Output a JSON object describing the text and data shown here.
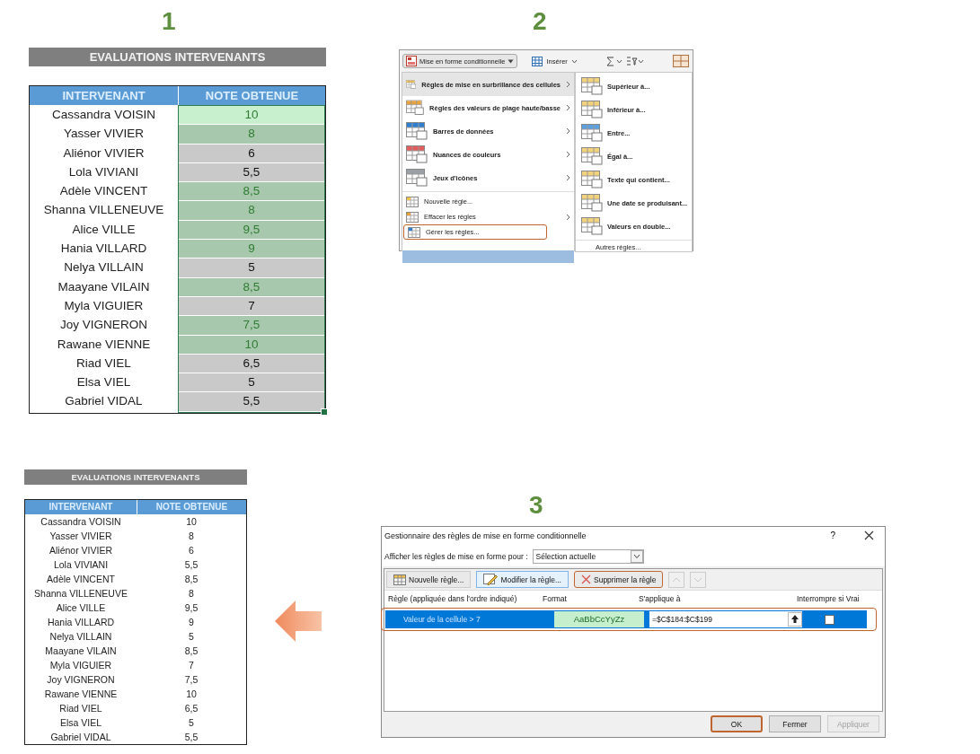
{
  "step_1": {
    "number": "1"
  },
  "table_before": {
    "title": "EVALUATIONS INTERVENANTS",
    "columns": [
      "INTERVENANT",
      "NOTE OBTENUE"
    ],
    "rows": [
      {
        "name": "Cassandra VOISIN",
        "note": "10",
        "highlighted": true,
        "active": true
      },
      {
        "name": "Yasser VIVIER",
        "note": "8",
        "highlighted": true,
        "active": false
      },
      {
        "name": "Aliénor VIVIER",
        "note": "6",
        "highlighted": false,
        "active": false
      },
      {
        "name": "Lola VIVIANI",
        "note": "5,5",
        "highlighted": false,
        "active": false
      },
      {
        "name": "Adèle VINCENT",
        "note": "8,5",
        "highlighted": true,
        "active": false
      },
      {
        "name": "Shanna VILLENEUVE",
        "note": "8",
        "highlighted": true,
        "active": false
      },
      {
        "name": "Alice VILLE",
        "note": "9,5",
        "highlighted": true,
        "active": false
      },
      {
        "name": "Hania VILLARD",
        "note": "9",
        "highlighted": true,
        "active": false
      },
      {
        "name": "Nelya VILLAIN",
        "note": "5",
        "highlighted": false,
        "active": false
      },
      {
        "name": "Maayane VILAIN",
        "note": "8,5",
        "highlighted": true,
        "active": false
      },
      {
        "name": "Myla VIGUIER",
        "note": "7",
        "highlighted": false,
        "active": false
      },
      {
        "name": "Joy VIGNERON",
        "note": "7,5",
        "highlighted": true,
        "active": false
      },
      {
        "name": "Rawane VIENNE",
        "note": "10",
        "highlighted": true,
        "active": false
      },
      {
        "name": "Riad VIEL",
        "note": "6,5",
        "highlighted": false,
        "active": false
      },
      {
        "name": "Elsa VIEL",
        "note": "5",
        "highlighted": false,
        "active": false
      },
      {
        "name": "Gabriel VIDAL",
        "note": "5,5",
        "highlighted": false,
        "active": false
      }
    ]
  },
  "step_2": {
    "number": "2"
  },
  "ribbon": {
    "conditional_format_button": "Mise en forme conditionnelle",
    "insert_button": "Insérer"
  },
  "menu": {
    "items": [
      {
        "label": "Règles de mise en surbrillance des cellules",
        "kind": "big",
        "submenu": true,
        "selected": true,
        "outlined": false
      },
      {
        "label": "Règles des valeurs de plage haute/basse",
        "kind": "big",
        "submenu": true,
        "selected": false,
        "outlined": false
      },
      {
        "label": "Barres de données",
        "kind": "big",
        "submenu": true,
        "selected": false,
        "outlined": false
      },
      {
        "label": "Nuances de couleurs",
        "kind": "big",
        "submenu": true,
        "selected": false,
        "outlined": false
      },
      {
        "label": "Jeux d'icônes",
        "kind": "big",
        "submenu": true,
        "selected": false,
        "outlined": false
      },
      {
        "label": "Nouvelle règle...",
        "kind": "small",
        "submenu": false,
        "selected": false,
        "outlined": false
      },
      {
        "label": "Effacer les règles",
        "kind": "small",
        "submenu": true,
        "selected": false,
        "outlined": false
      },
      {
        "label": "Gérer les règles...",
        "kind": "small",
        "submenu": false,
        "selected": false,
        "outlined": true
      }
    ],
    "submenu": [
      "Supérieur à...",
      "Inférieur à...",
      "Entre...",
      "Égal à...",
      "Texte qui contient...",
      "Une date se produisant...",
      "Valeurs en double..."
    ],
    "submenu_footer": "Autres règles..."
  },
  "step_3": {
    "number": "3"
  },
  "dialog": {
    "title": "Gestionnaire des règles de mise en forme conditionnelle",
    "help": "?",
    "show_for_label": "Afficher les règles de mise en forme pour :",
    "show_for_value": "Sélection actuelle",
    "toolbar": [
      {
        "label": "Nouvelle règle...",
        "outlined": false,
        "focused": false
      },
      {
        "label": "Modifier la règle...",
        "outlined": false,
        "focused": true
      },
      {
        "label": "Supprimer la règle",
        "outlined": true,
        "focused": false
      }
    ],
    "columns": [
      "Règle (appliquée dans l'ordre indiqué)",
      "Format",
      "S'applique à",
      "Interrompre si Vrai"
    ],
    "rules": [
      {
        "rule": "Valeur de la cellule > 7",
        "format_sample": "AaBbCcYyZz",
        "applies_to": "=$C$184:$C$199",
        "stop_if_true": false,
        "selected": true,
        "outlined": true
      }
    ],
    "buttons": [
      {
        "label": "OK",
        "outlined": true,
        "disabled": false
      },
      {
        "label": "Fermer",
        "outlined": false,
        "disabled": false
      },
      {
        "label": "Appliquer",
        "outlined": false,
        "disabled": true
      }
    ]
  },
  "table_after": {
    "title": "EVALUATIONS INTERVENANTS",
    "columns": [
      "INTERVENANT",
      "NOTE OBTENUE"
    ],
    "rows": [
      {
        "name": "Cassandra VOISIN",
        "note": "10"
      },
      {
        "name": "Yasser VIVIER",
        "note": "8"
      },
      {
        "name": "Aliénor VIVIER",
        "note": "6"
      },
      {
        "name": "Lola VIVIANI",
        "note": "5,5"
      },
      {
        "name": "Adèle VINCENT",
        "note": "8,5"
      },
      {
        "name": "Shanna VILLENEUVE",
        "note": "8"
      },
      {
        "name": "Alice VILLE",
        "note": "9,5"
      },
      {
        "name": "Hania VILLARD",
        "note": "9"
      },
      {
        "name": "Nelya VILLAIN",
        "note": "5"
      },
      {
        "name": "Maayane VILAIN",
        "note": "8,5"
      },
      {
        "name": "Myla VIGUIER",
        "note": "7"
      },
      {
        "name": "Joy VIGNERON",
        "note": "7,5"
      },
      {
        "name": "Rawane VIENNE",
        "note": "10"
      },
      {
        "name": "Riad VIEL",
        "note": "6,5"
      },
      {
        "name": "Elsa VIEL",
        "note": "5"
      },
      {
        "name": "Gabriel VIDAL",
        "note": "5,5"
      }
    ]
  }
}
